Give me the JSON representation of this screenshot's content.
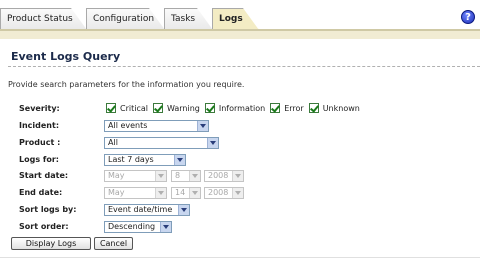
{
  "tabs": [
    {
      "label": "Product Status",
      "active": false
    },
    {
      "label": "Configuration",
      "active": false
    },
    {
      "label": "Tasks",
      "active": false
    },
    {
      "label": "Logs",
      "active": true
    }
  ],
  "help_icon": {
    "symbol": "?",
    "name": "help-icon"
  },
  "page_title": "Event Logs Query",
  "instructions": "Provide search parameters for the information you require.",
  "severity": {
    "label": "Severity:",
    "options": [
      {
        "label": "Critical",
        "checked": true
      },
      {
        "label": "Warning",
        "checked": true
      },
      {
        "label": "Information",
        "checked": true
      },
      {
        "label": "Error",
        "checked": true
      },
      {
        "label": "Unknown",
        "checked": true
      }
    ]
  },
  "incident": {
    "label": "Incident:",
    "value": "All events"
  },
  "product": {
    "label": "Product :",
    "value": "All"
  },
  "logs_for": {
    "label": "Logs for:",
    "value": "Last 7 days"
  },
  "start_date": {
    "label": "Start date:",
    "month": "May",
    "day": "8",
    "year": "2008",
    "disabled": true
  },
  "end_date": {
    "label": "End date:",
    "month": "May",
    "day": "14",
    "year": "2008",
    "disabled": true
  },
  "sort_by": {
    "label": "Sort logs by:",
    "value": "Event date/time"
  },
  "sort_order": {
    "label": "Sort order:",
    "value": "Descending"
  },
  "buttons": {
    "display_logs": "Display Logs",
    "cancel": "Cancel"
  },
  "colors": {
    "active_tab": "#f3ecc4",
    "tab_strip": "#f1ecd3",
    "title": "#1b2a4a",
    "checkbox_check": "#1a7a1a"
  }
}
